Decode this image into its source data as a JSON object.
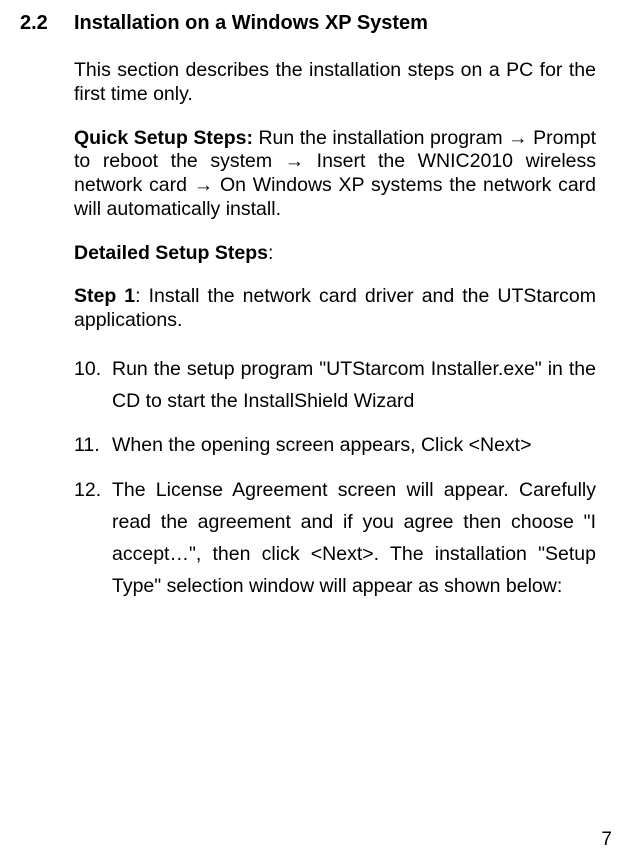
{
  "section": {
    "number": "2.2",
    "title": "Installation on a Windows XP System"
  },
  "intro": "This section describes the installation steps on a PC for the first time only.",
  "quick_label": "Quick Setup Steps:",
  "quick_text": " Run the installation program → Prompt to reboot the system → Insert the WNIC2010 wireless network card → On Windows XP systems the network card will automatically install.",
  "detailed_label": "Detailed Setup Steps",
  "detailed_colon": ":",
  "step1_label": "Step 1",
  "step1_text": ": Install the network card driver and the UTStarcom applications.",
  "items": [
    {
      "num": "10.",
      "text": "Run the setup program \"UTStarcom Installer.exe\" in the CD to start the InstallShield Wizard"
    },
    {
      "num": "11.",
      "text": "When the opening screen appears, Click <Next>"
    },
    {
      "num": "12.",
      "text": "The License Agreement screen will appear. Carefully read the agreement and if you agree then choose \"I accept…\", then click <Next>.  The installation \"Setup Type\" selection window will appear as shown below:"
    }
  ],
  "page_number": "7"
}
